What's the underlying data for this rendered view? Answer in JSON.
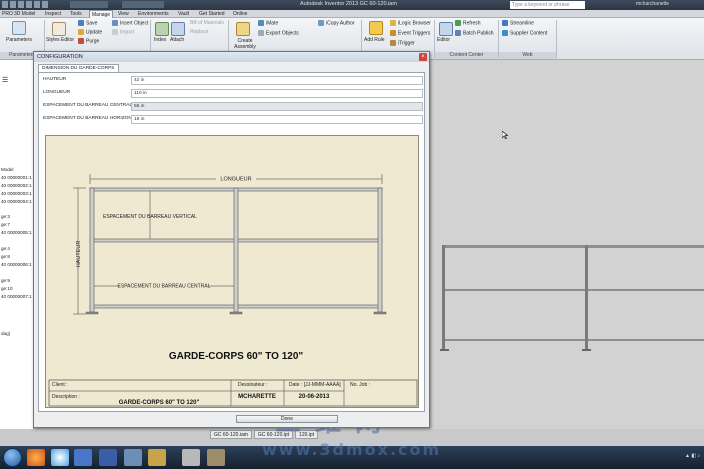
{
  "titlebar": {
    "title": "Autodesk Inventor 2013   GC 60-120.iam",
    "search_placeholder": "Type a keyword or phrase",
    "user": "mcharchanette"
  },
  "menubar": {
    "tabs": [
      "PRO",
      "3D Model",
      "Inspect",
      "Tools",
      "Manage",
      "View",
      "Environments",
      "Vault",
      "Get Started",
      "Online"
    ],
    "active": "Manage"
  },
  "ribbon": {
    "parameters_label": "Parameters",
    "save_label": "Save",
    "update_label": "Update",
    "purge_label": "Purge",
    "insert_object_label": "Insert Object",
    "import_label": "Import",
    "styles_editor_label": "Styles Editor",
    "index_label": "Index",
    "attach_label": "Attach",
    "bom_text": "Bill of Materials",
    "replace_label": "Replace",
    "create_assembly_label": "Create Assembly",
    "ilogic_browser_label": "iLogic Browser",
    "imate_label": "iMate",
    "export_objects_label": "Export Objects",
    "icopy_author_label": "iCopy Author",
    "add_rule_label": "Add Rule",
    "event_triggers_label": "Event Triggers",
    "itrigger_label": "iTrigger",
    "editor_label": "Editor",
    "refresh_label": "Refresh",
    "batch_publish_label": "Batch Publish",
    "streamline_label": "Streamline",
    "supplier_content_label": "Supplier Content",
    "parameters_panel": "Parameters",
    "content_center_panel": "Content Center",
    "web_panel": "Web"
  },
  "browser": {
    "items": [
      "Model",
      "40 00000001:1",
      "40 00000002:1",
      "40 00000003:1",
      "40 00000004:1",
      "ge:3",
      "ge:7",
      "40 00000005:1",
      "ge:4",
      "ge:8",
      "40 00000006:1",
      "ge:9",
      "ge:10",
      "40 00000007:1",
      "dag)"
    ]
  },
  "dialog": {
    "title": "CONFIGURATION",
    "tab": "DIMENSION DU GARDE-CORPS",
    "done_label": "Done",
    "fields": [
      {
        "label": "HAUTEUR",
        "value": "42 in",
        "readonly": false
      },
      {
        "label": "LONGUEUR",
        "value": "110 in",
        "readonly": false
      },
      {
        "label": "ESPACEMENT DU BARREAU CENTRAL",
        "value": "55 in",
        "readonly": true
      },
      {
        "label": "ESPACEMENT DU BARREAU HORIZONTAL",
        "value": "18 in",
        "readonly": false
      }
    ]
  },
  "drawing": {
    "dim_longueur": "LONGUEUR",
    "dim_hauteur": "HAUTEUR",
    "dim_vertical": "ESPACEMENT DU BARREAU VERTICAL",
    "dim_central": "ESPACEMENT DU BARREAU CENTRAL",
    "title": "GARDE-CORPS 60\" TO 120\"",
    "client_label": "Client :",
    "designer_label": "Dessinateur :",
    "date_label": "Date : [JJ-MMM-AAAA]",
    "job_label": "No. Job :",
    "description_label": "Description :",
    "description_value": "GARDE-CORPS 60\" TO 120\"",
    "designer_value": "MCHARETTE",
    "date_value": "20-06-2013"
  },
  "doctabs": [
    "GC 60-120.iam",
    "GC 60-120.ipt",
    "120.ipt"
  ],
  "watermark": {
    "chars": "三维网",
    "url": "www.3dmox.com"
  },
  "colors": {
    "drawing_bg": "#efe9d2",
    "railing_line": "#555555",
    "dialog_bg": "#eceef0"
  }
}
